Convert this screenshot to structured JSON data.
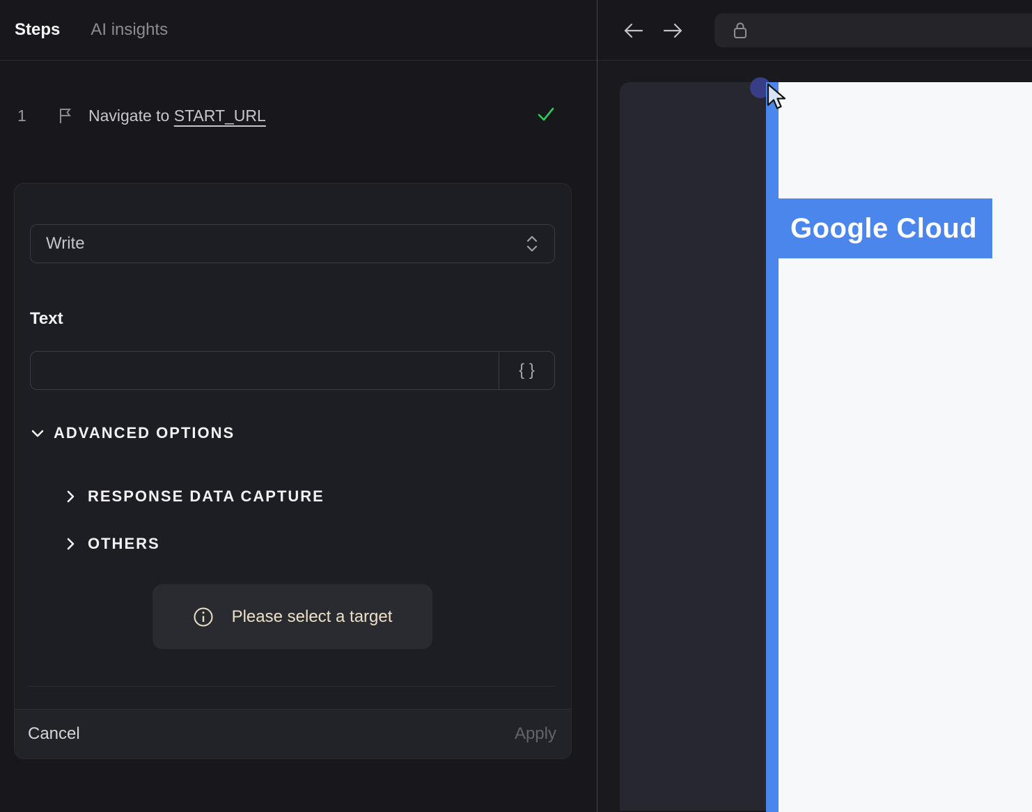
{
  "left_panel": {
    "tabs": [
      {
        "label": "Steps",
        "active": true
      },
      {
        "label": "AI insights",
        "active": false
      }
    ],
    "step": {
      "index": "1",
      "label_prefix": "Navigate to ",
      "label_link": "START_URL",
      "status": "success"
    },
    "editor": {
      "action_select": {
        "value": "Write"
      },
      "text_field": {
        "label": "Text",
        "value": "",
        "braces_label": "{ }"
      },
      "advanced_options_label": "ADVANCED OPTIONS",
      "sections": [
        {
          "label": "RESPONSE DATA CAPTURE",
          "collapsed": true
        },
        {
          "label": "OTHERS",
          "collapsed": true
        }
      ],
      "toast": {
        "message": "Please select a target"
      },
      "footer": {
        "cancel_label": "Cancel",
        "apply_label": "Apply",
        "apply_enabled": false
      }
    }
  },
  "browser": {
    "url_bar": {
      "value": ""
    },
    "page": {
      "hero_label": "Google Cloud"
    }
  },
  "icons": [
    "flag-icon",
    "check-icon",
    "chevron-updown-icon",
    "chevron-down-icon",
    "chevron-right-icon",
    "braces-icon",
    "info-icon",
    "arrow-left-icon",
    "arrow-right-icon",
    "lock-icon",
    "cursor-pointer-icon"
  ],
  "colors": {
    "background": "#18181c",
    "card": "#1d1e23",
    "accent_blue": "#4a86ec",
    "success_green": "#2fcb5c",
    "toast_text": "#ece0c8",
    "page_white": "#f7f8f9",
    "screen_dark": "#26272f"
  }
}
